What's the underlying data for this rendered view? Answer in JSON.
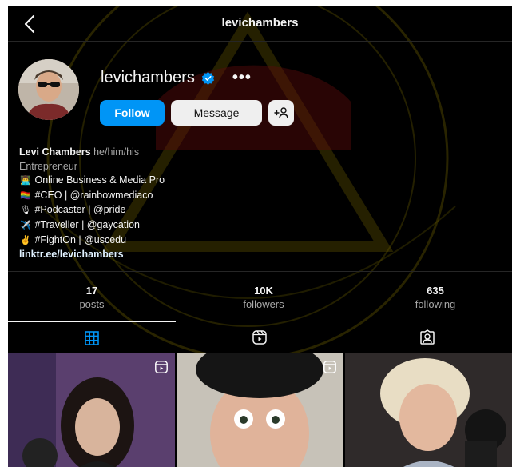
{
  "topbar": {
    "title": "levichambers"
  },
  "profile": {
    "username": "levichambers",
    "follow_label": "Follow",
    "message_label": "Message",
    "suggest_label": "+ᴙ"
  },
  "bio": {
    "name": "Levi Chambers",
    "pronouns": "he/him/his",
    "category": "Entrepreneur",
    "lines": [
      {
        "emoji": "👨‍💻",
        "text": "Online Business & Media Pro"
      },
      {
        "emoji": "🏳️‍🌈",
        "text": "#CEO | @rainbowmediaco"
      },
      {
        "emoji": "🎙",
        "text": "#Podcaster | @pride"
      },
      {
        "emoji": "✈️",
        "text": "#Traveller | @gaycation"
      },
      {
        "emoji": "✌️",
        "text": "#FightOn | @uscedu"
      }
    ],
    "link": "linktr.ee/levichambers"
  },
  "stats": [
    {
      "value": "17",
      "label": "posts"
    },
    {
      "value": "10K",
      "label": "followers"
    },
    {
      "value": "635",
      "label": "following"
    }
  ],
  "tabs": [
    {
      "icon": "grid-icon",
      "active": true
    },
    {
      "icon": "reels-icon",
      "active": false
    },
    {
      "icon": "tagged-icon",
      "active": false
    }
  ],
  "colors": {
    "background": "#000000",
    "follow": "#0095f6",
    "secondary_button": "#efefef",
    "verified": "#0095f6",
    "muted_text": "#a8a8a8"
  }
}
